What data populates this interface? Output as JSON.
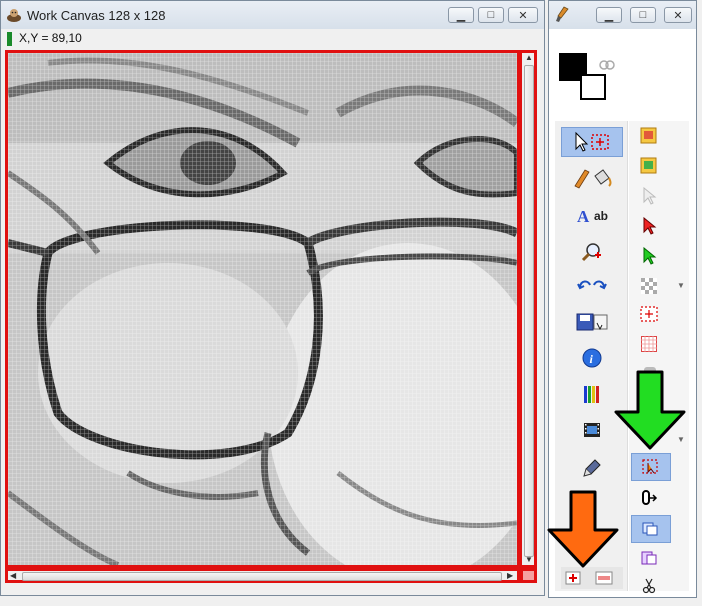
{
  "canvas_window": {
    "title": "Work Canvas 128 x 128",
    "coords": "X,Y = 89,10",
    "minimize": "▁",
    "maximize": "□",
    "close": "✕"
  },
  "tools_window": {
    "minimize": "▁",
    "maximize": "□",
    "close": "✕",
    "text_tool_label": "ab"
  },
  "colors": {
    "accent_red": "#e01010",
    "arrow_green": "#22dd22",
    "arrow_orange": "#ff6a10",
    "selected_tool": "#a6c3ee"
  }
}
